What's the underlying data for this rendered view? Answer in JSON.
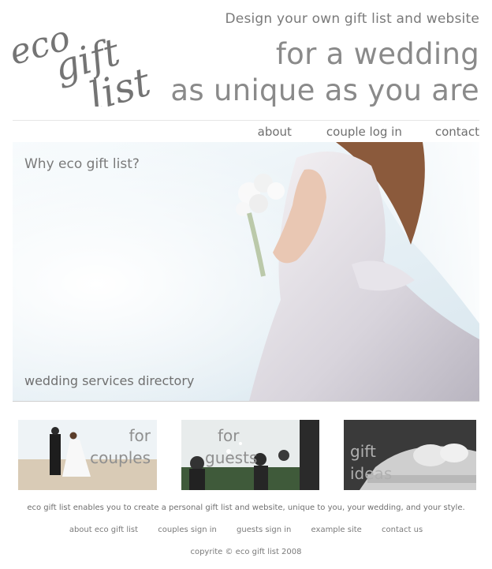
{
  "logo": {
    "line1": "eco",
    "line2": "gift",
    "line3": "list"
  },
  "header": {
    "tagline_small": "Design your own gift list and website",
    "tagline_line1": "for a wedding",
    "tagline_line2": "as unique as you are"
  },
  "nav": {
    "about": "about",
    "couple_login": "couple log in",
    "contact": "contact"
  },
  "hero": {
    "why": "Why eco gift list?",
    "directory": "wedding services directory"
  },
  "tiles": {
    "couples": {
      "line1": "for",
      "line2": "couples"
    },
    "guests": {
      "line1": "for",
      "line2": "guests"
    },
    "ideas": {
      "line1": "gift",
      "line2": "ideas"
    }
  },
  "description": "eco gift list enables you to create a personal gift list and website, unique to you, your wedding, and your style.",
  "footer_links": {
    "about": "about eco gift list",
    "couples": "couples sign in",
    "guests": "guests sign in",
    "example": "example site",
    "contact": "contact us"
  },
  "copyright": "copyrite © eco gift list 2008",
  "colors": {
    "text_grey": "#7a7a7a",
    "rule": "#e6e6e6",
    "background": "#ffffff"
  }
}
